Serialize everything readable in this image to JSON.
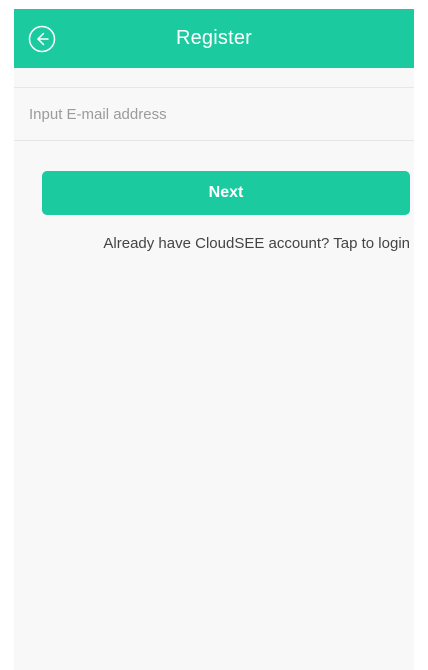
{
  "header": {
    "title": "Register",
    "back_icon": "back-arrow-circle-icon"
  },
  "form": {
    "email_value": "",
    "email_placeholder": "Input E-mail address",
    "next_label": "Next",
    "login_link": "Already have CloudSEE account? Tap to login"
  },
  "colors": {
    "accent": "#1ccaa0",
    "background": "#f8f8f8"
  }
}
